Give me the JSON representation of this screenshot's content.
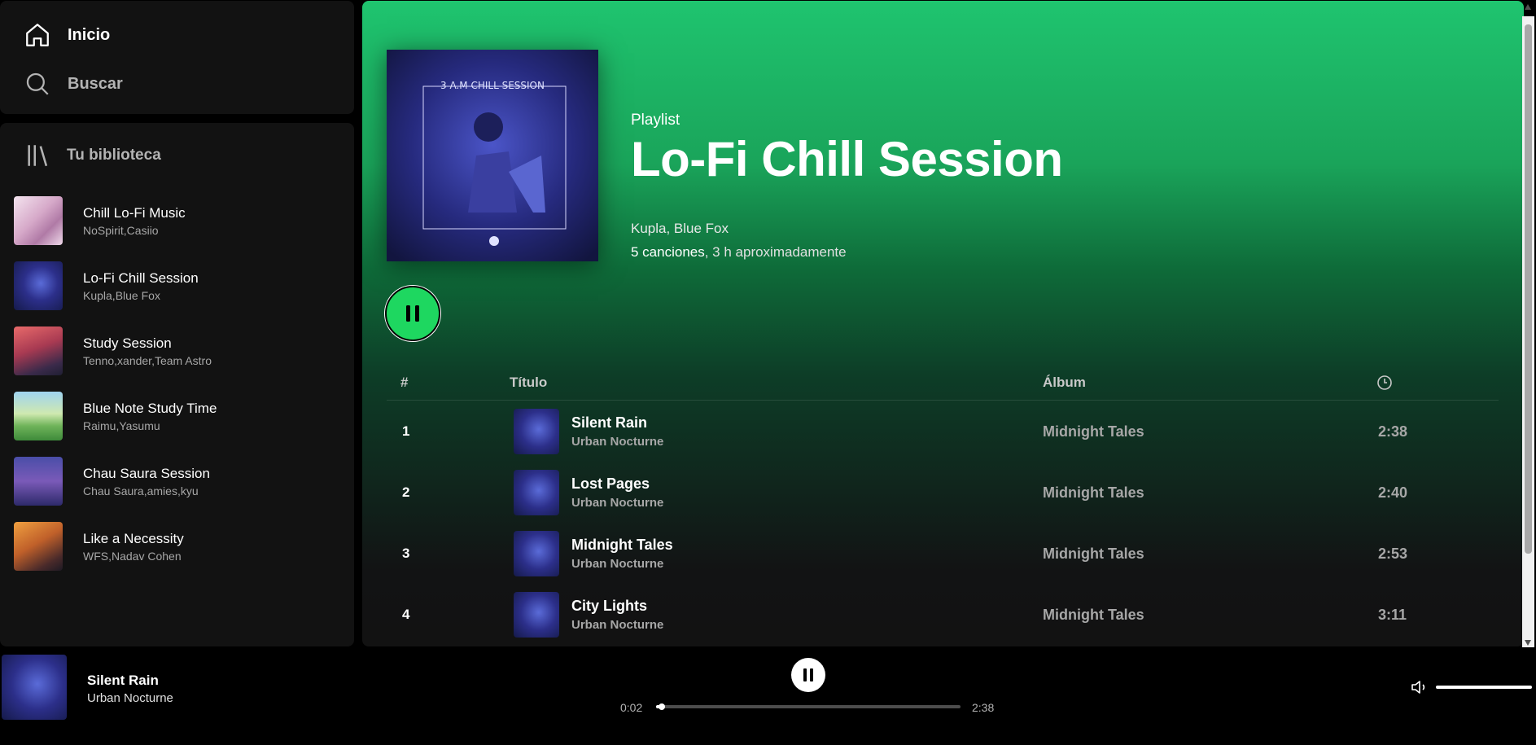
{
  "nav": {
    "home_label": "Inicio",
    "search_label": "Buscar"
  },
  "library": {
    "header": "Tu biblioteca",
    "items": [
      {
        "title": "Chill Lo-Fi Music",
        "subtitle": "NoSpirit,Casiio"
      },
      {
        "title": "Lo-Fi Chill Session",
        "subtitle": "Kupla,Blue Fox"
      },
      {
        "title": "Study Session",
        "subtitle": "Tenno,xander,Team Astro"
      },
      {
        "title": "Blue Note Study Time",
        "subtitle": "Raimu,Yasumu"
      },
      {
        "title": "Chau Saura Session",
        "subtitle": "Chau Saura,amies,kyu"
      },
      {
        "title": "Like a Necessity",
        "subtitle": "WFS,Nadav Cohen"
      }
    ]
  },
  "playlist": {
    "type": "Playlist",
    "title": "Lo-Fi Chill Session",
    "owners": "Kupla, Blue Fox",
    "song_count": "5 canciones",
    "duration": ", 3 h aproximadamente",
    "cover_text": "3 A.M CHILL SESSION"
  },
  "table": {
    "col_num": "#",
    "col_title": "Título",
    "col_album": "Álbum",
    "col_duration_icon": "clock-icon",
    "rows": [
      {
        "num": "1",
        "title": "Silent Rain",
        "artist": "Urban Nocturne",
        "album": "Midnight Tales",
        "duration": "2:38"
      },
      {
        "num": "2",
        "title": "Lost Pages",
        "artist": "Urban Nocturne",
        "album": "Midnight Tales",
        "duration": "2:40"
      },
      {
        "num": "3",
        "title": "Midnight Tales",
        "artist": "Urban Nocturne",
        "album": "Midnight Tales",
        "duration": "2:53"
      },
      {
        "num": "4",
        "title": "City Lights",
        "artist": "Urban Nocturne",
        "album": "Midnight Tales",
        "duration": "3:11"
      }
    ]
  },
  "player": {
    "title": "Silent Rain",
    "artist": "Urban Nocturne",
    "current_time": "0:02",
    "total_time": "2:38",
    "progress": 0.013,
    "volume": 1.0
  },
  "colors": {
    "accent": "#1ed760",
    "header_green": "#1fc46f",
    "panel": "#121212"
  }
}
